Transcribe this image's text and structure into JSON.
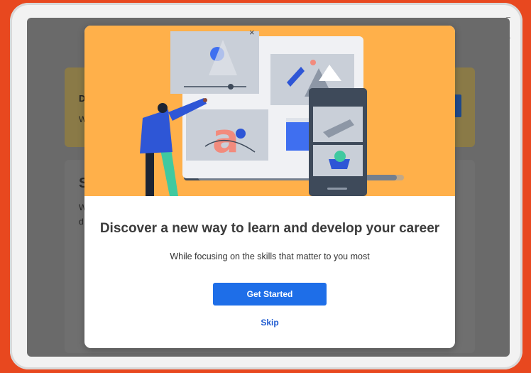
{
  "background": {
    "card1_title": "D",
    "card1_text": "W",
    "card2_title": "S",
    "card2_line1": "W",
    "card2_line2": "d"
  },
  "modal": {
    "headline": "Discover a new way to learn and develop your career",
    "subheadline": "While focusing on the skills that matter to you most",
    "primary_button": "Get Started",
    "secondary_link": "Skip",
    "close_glyph": "×",
    "illustration_letter": "a"
  },
  "colors": {
    "page_bg": "#e8481f",
    "hero_bg": "#ffb04a",
    "primary": "#1e6ee8",
    "link": "#1e5bd0"
  }
}
